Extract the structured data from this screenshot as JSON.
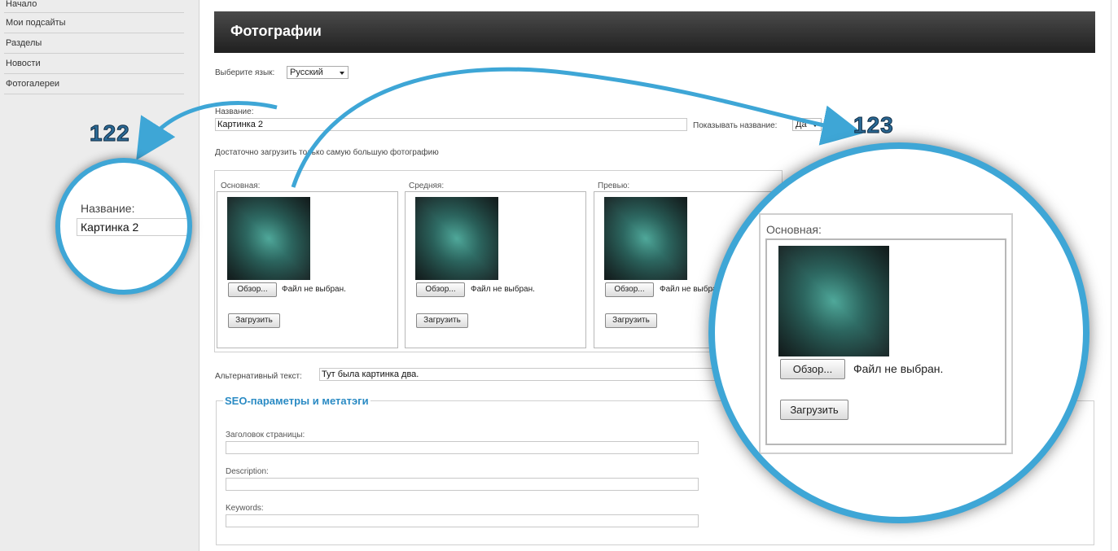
{
  "sidebar": {
    "items": [
      {
        "label": "Начало"
      },
      {
        "label": "Мои подсайты"
      },
      {
        "label": "Разделы"
      },
      {
        "label": "Новости"
      },
      {
        "label": "Фотогалереи"
      }
    ]
  },
  "header": {
    "title": "Фотографии"
  },
  "language": {
    "label": "Выберите язык:",
    "value": "Русский"
  },
  "name": {
    "label": "Название:",
    "value": "Картинка 2"
  },
  "show_name": {
    "label": "Показывать название:",
    "value": "Да"
  },
  "hint": "Достаточно загрузить только самую большую фотографию",
  "uploads": [
    {
      "label": "Основная:",
      "browse": "Обзор...",
      "status": "Файл не выбран.",
      "upload": "Загрузить"
    },
    {
      "label": "Средняя:",
      "browse": "Обзор...",
      "status": "Файл не выбран.",
      "upload": "Загрузить"
    },
    {
      "label": "Превью:",
      "browse": "Обзор...",
      "status": "Файл не выбран.",
      "upload": "Загрузить"
    }
  ],
  "alt_text": {
    "label": "Альтернативный текст:",
    "value": "Тут была картинка два."
  },
  "seo": {
    "legend": "SEO-параметры и метатэги",
    "fields": [
      {
        "label": "Заголовок страницы:"
      },
      {
        "label": "Description:"
      },
      {
        "label": "Keywords:"
      }
    ]
  },
  "callouts": {
    "left_number": "122",
    "right_number": "123",
    "left_zoom": {
      "label": "Название:",
      "value": "Картинка 2"
    },
    "right_zoom": {
      "label": "Основная:",
      "browse": "Обзор...",
      "status": "Файл не выбран.",
      "upload": "Загрузить"
    }
  },
  "colors": {
    "accent": "#3ea6d6",
    "seo_legend": "#2b8bc4",
    "header_bg": "#2a2a2a",
    "sidebar_bg": "#ececec"
  }
}
